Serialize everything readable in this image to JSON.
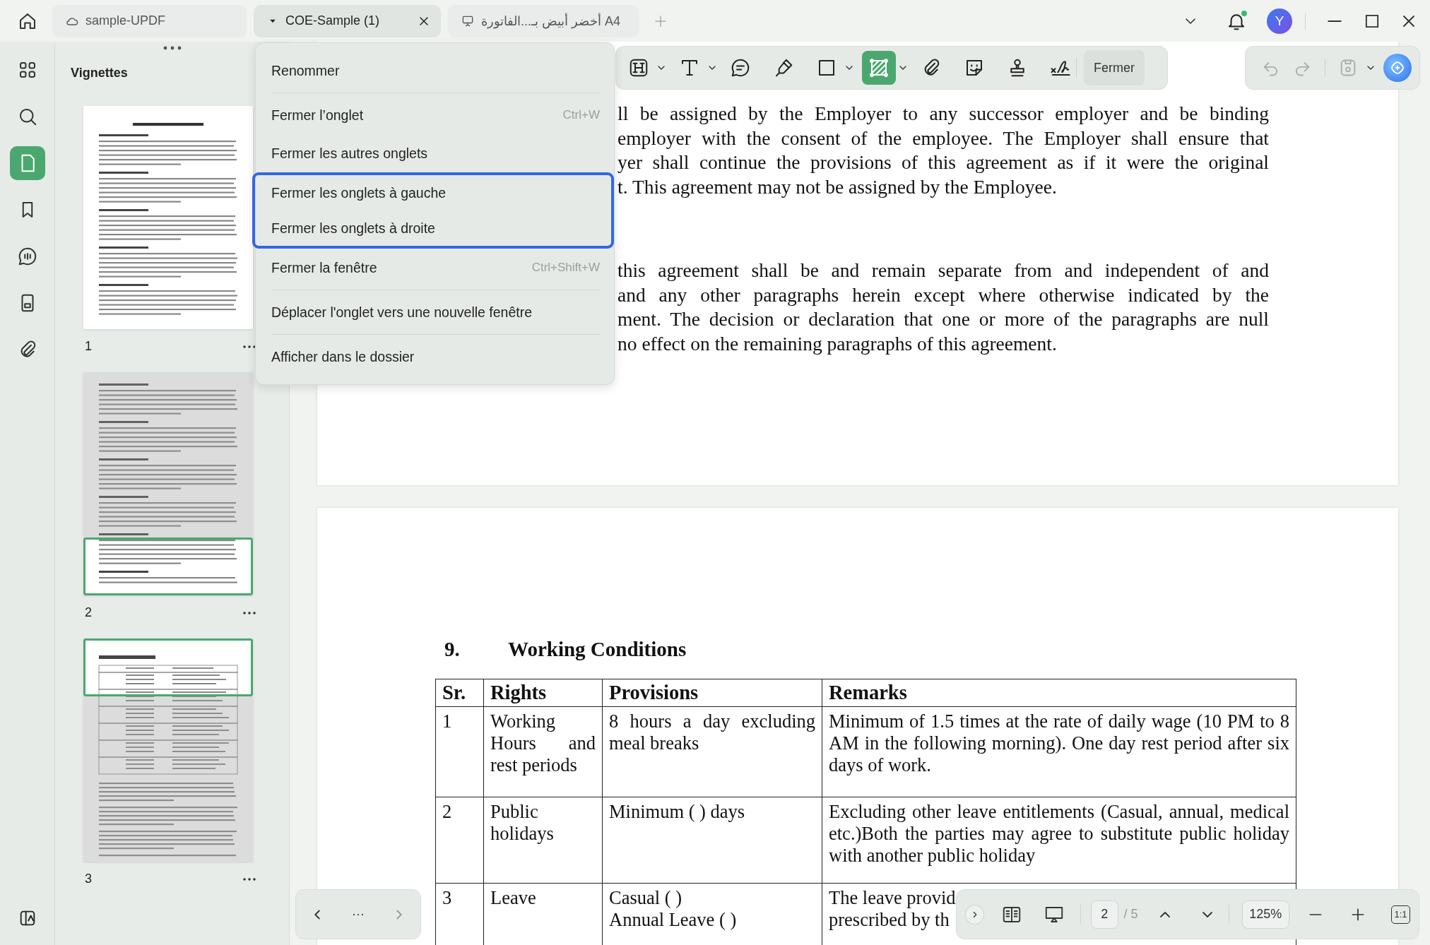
{
  "tabs": [
    {
      "title": "sample-UPDF",
      "kind": "cloud",
      "selected": false
    },
    {
      "title": "COE-Sample (1)",
      "kind": "local",
      "selected": true
    },
    {
      "title": "A4 أخضر أبيض بـ...الفاتورة",
      "kind": "slides",
      "selected": false
    }
  ],
  "notifications": {
    "unread": true
  },
  "user": {
    "initial": "Y"
  },
  "rail": {
    "items": [
      {
        "kind": "apps",
        "selected": false
      },
      {
        "kind": "search",
        "selected": false
      },
      {
        "kind": "pages",
        "selected": true
      },
      {
        "kind": "bookmarks",
        "selected": false
      },
      {
        "kind": "comments",
        "selected": false
      },
      {
        "kind": "forms",
        "selected": false
      },
      {
        "kind": "attachments",
        "selected": false
      }
    ]
  },
  "thumbnails": {
    "title": "Vignettes",
    "pages": [
      {
        "label": "1",
        "viewport_top": false,
        "viewport_bottom": false
      },
      {
        "label": "2",
        "viewport_top": false,
        "viewport_bottom": true
      },
      {
        "label": "3",
        "viewport_top": true,
        "viewport_bottom": false
      }
    ]
  },
  "toolbar": {
    "tools": [
      {
        "kind": "heading",
        "dropdown": true,
        "selected": false
      },
      {
        "kind": "text",
        "dropdown": true,
        "selected": false
      },
      {
        "kind": "comment",
        "dropdown": false,
        "selected": false
      },
      {
        "kind": "highlighter",
        "dropdown": false,
        "selected": false
      },
      {
        "kind": "shape",
        "dropdown": true,
        "selected": false
      },
      {
        "kind": "area",
        "dropdown": true,
        "selected": true
      },
      {
        "kind": "attachment",
        "dropdown": false,
        "selected": false
      },
      {
        "kind": "sticker",
        "dropdown": false,
        "selected": false
      },
      {
        "kind": "stamp",
        "dropdown": false,
        "selected": false
      },
      {
        "kind": "signature",
        "dropdown": false,
        "selected": false
      }
    ],
    "close_label": "Fermer",
    "actions": [
      {
        "kind": "undo",
        "disabled": true,
        "dropdown": false
      },
      {
        "kind": "redo",
        "disabled": true,
        "dropdown": false
      },
      {
        "kind": "save",
        "disabled": true,
        "dropdown": true
      },
      {
        "kind": "ai",
        "disabled": false,
        "dropdown": false
      }
    ]
  },
  "menu": {
    "items": [
      {
        "label": "Renommer",
        "separator_after": true,
        "highlighted": false
      },
      {
        "label": "Fermer l’onglet",
        "shortcut": "Ctrl+W",
        "separator_after": false,
        "highlighted": false
      },
      {
        "label": "Fermer les autres onglets",
        "separator_after": false,
        "highlighted": false
      },
      {
        "label": "Fermer les onglets à gauche",
        "separator_after": false,
        "highlighted": true
      },
      {
        "label": "Fermer les onglets à droite",
        "separator_after": false,
        "highlighted": true
      },
      {
        "label": "Fermer la fenêtre",
        "shortcut": "Ctrl+Shift+W",
        "separator_after": true,
        "highlighted": false
      },
      {
        "label": "Déplacer l'onglet vers une nouvelle fenêtre",
        "separator_after": true,
        "highlighted": false
      },
      {
        "label": "Afficher dans le dossier",
        "separator_after": false,
        "highlighted": false
      }
    ]
  },
  "document": {
    "page_1": {
      "paragraphs": [
        [
          "ll be assigned by the Employer to any successor employer and be binding",
          "employer with the consent of the employee. The Employer shall ensure that",
          "yer shall continue the provisions of this agreement as if it were the original",
          "t. This agreement may not be assigned by the Employee."
        ],
        [
          "this agreement shall be and remain separate from and independent of and",
          "and any other paragraphs herein except where otherwise indicated by the",
          "ment. The decision or declaration that one or more of the paragraphs are null",
          "no effect on the remaining paragraphs of this agreement."
        ]
      ]
    },
    "page_2": {
      "section_number": "9.",
      "section_title": "Working Conditions",
      "table": {
        "columns": [
          "Sr.",
          "Rights",
          "Provisions",
          "Remarks"
        ],
        "rows": [
          {
            "cells": [
              "1",
              "Working Hours and rest periods",
              "8 hours a day excluding meal breaks",
              "Minimum of 1.5 times at the rate of daily wage (10 PM to 8 AM in the following morning). One day rest period after six days of work."
            ]
          },
          {
            "cells": [
              "2",
              "Public holidays",
              "Minimum ( ) days",
              "Excluding other leave entitlements (Casual, annual, medical etc.)Both the parties may agree to substitute public holiday with another public holiday"
            ]
          },
          {
            "cells": [
              "3",
              "Leave",
              "Casual  ( )\nAnnual Leave ( )",
              "The leave provid\nprescribed by th"
            ]
          }
        ]
      }
    }
  },
  "pager": {
    "prev_disabled": false,
    "more": "···",
    "next_disabled": true,
    "page_input": "2",
    "page_total": "/ 5",
    "zoom": "125%",
    "actual_size": "1:1"
  }
}
